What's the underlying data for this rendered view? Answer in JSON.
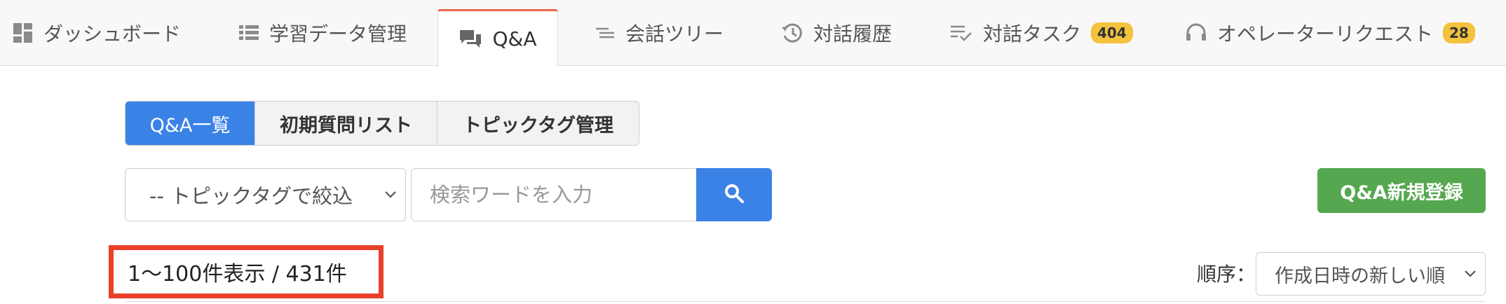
{
  "nav": {
    "tabs": [
      {
        "label": "ダッシュボード",
        "icon": "dashboard-icon"
      },
      {
        "label": "学習データ管理",
        "icon": "list-icon"
      },
      {
        "label": "Q&A",
        "icon": "chat-bubbles-icon",
        "active": true
      },
      {
        "label": "会話ツリー",
        "icon": "tree-lines-icon"
      },
      {
        "label": "対話履歴",
        "icon": "history-icon"
      },
      {
        "label": "対話タスク",
        "icon": "task-check-icon",
        "badge": "404"
      },
      {
        "label": "オペレーターリクエスト",
        "icon": "headset-icon",
        "badge": "28"
      }
    ]
  },
  "subtabs": [
    {
      "label": "Q&A一覧",
      "active": true
    },
    {
      "label": "初期質問リスト"
    },
    {
      "label": "トピックタグ管理"
    }
  ],
  "filters": {
    "topic_select": "-- トピックタグで絞込",
    "search_placeholder": "検索ワードを入力",
    "new_button": "Q&A新規登録"
  },
  "results": {
    "count_text": "1〜100件表示 / 431件",
    "order_label": "順序：",
    "order_value": "作成日時の新しい順"
  },
  "colors": {
    "accent_blue": "#3b82e6",
    "green": "#55a84f",
    "badge_yellow": "#f5c23e",
    "highlight_red": "#e8402b",
    "active_tab_top": "#e9684a"
  }
}
